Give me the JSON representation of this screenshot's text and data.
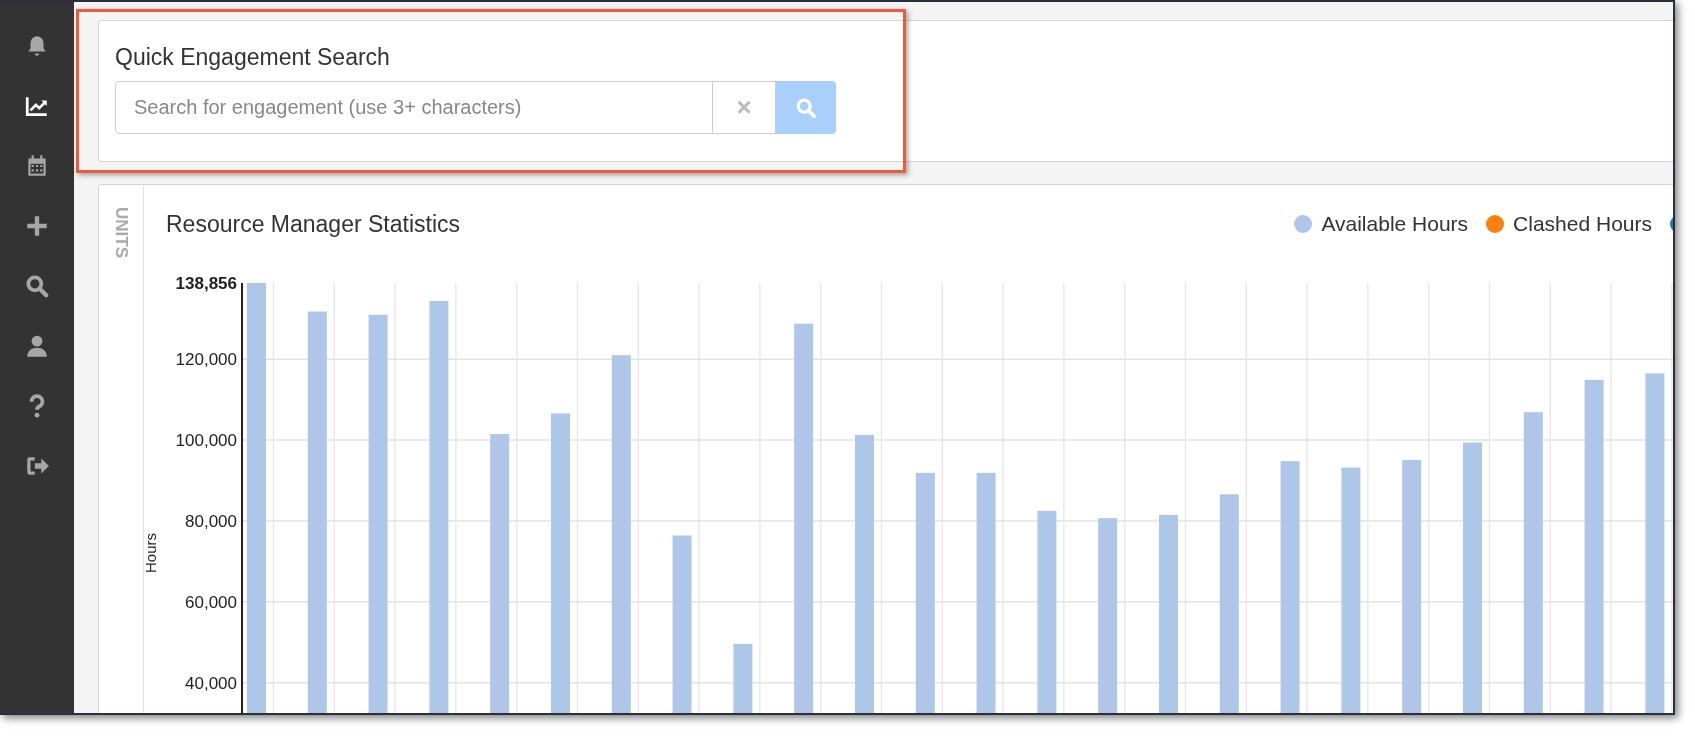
{
  "sidebar": {
    "items": [
      {
        "selected": false
      },
      {
        "selected": true
      },
      {
        "selected": false
      },
      {
        "selected": false
      },
      {
        "selected": false
      },
      {
        "selected": false
      },
      {
        "selected": false
      },
      {
        "selected": false
      }
    ]
  },
  "quick_search": {
    "title": "Quick Engagement Search",
    "placeholder": "Search for engagement (use 3+ characters)",
    "clear_button": "×"
  },
  "statistics": {
    "side_label": "UNITS",
    "title": "Resource Manager Statistics",
    "chart_data": {
      "type": "bar",
      "ylabel": "Hours",
      "ylim": [
        32000,
        138856
      ],
      "grid": true,
      "yticks": [
        {
          "value": 40000,
          "label": "40,000"
        },
        {
          "value": 60000,
          "label": "60,000"
        },
        {
          "value": 80000,
          "label": "80,000"
        },
        {
          "value": 100000,
          "label": "100,000"
        },
        {
          "value": 120000,
          "label": "120,000"
        },
        {
          "value": 138856,
          "label": "138,856"
        }
      ],
      "series": [
        {
          "name": "Available Hours",
          "color": "#aec7e8",
          "values": [
            138856,
            131800,
            131000,
            134400,
            101500,
            106600,
            121000,
            76400,
            49600,
            128800,
            101300,
            91900,
            91900,
            82500,
            80700,
            81500,
            86600,
            94800,
            93200,
            95100,
            99400,
            106900,
            114900,
            116500
          ]
        },
        {
          "name": "Clashed Hours",
          "color": "#ff7f0e",
          "values": [
            null,
            null,
            null,
            null,
            null,
            null,
            null,
            null,
            null,
            null,
            null,
            null,
            null,
            null,
            null,
            null,
            null,
            null,
            null,
            null,
            null,
            null,
            null,
            null
          ]
        },
        {
          "color": "#1f77b4",
          "values": [
            null,
            null,
            null,
            null,
            null,
            null,
            null,
            null,
            null,
            null,
            null,
            null,
            null,
            null,
            null,
            null,
            null,
            null,
            null,
            null,
            null,
            null,
            null,
            null
          ]
        }
      ]
    }
  }
}
